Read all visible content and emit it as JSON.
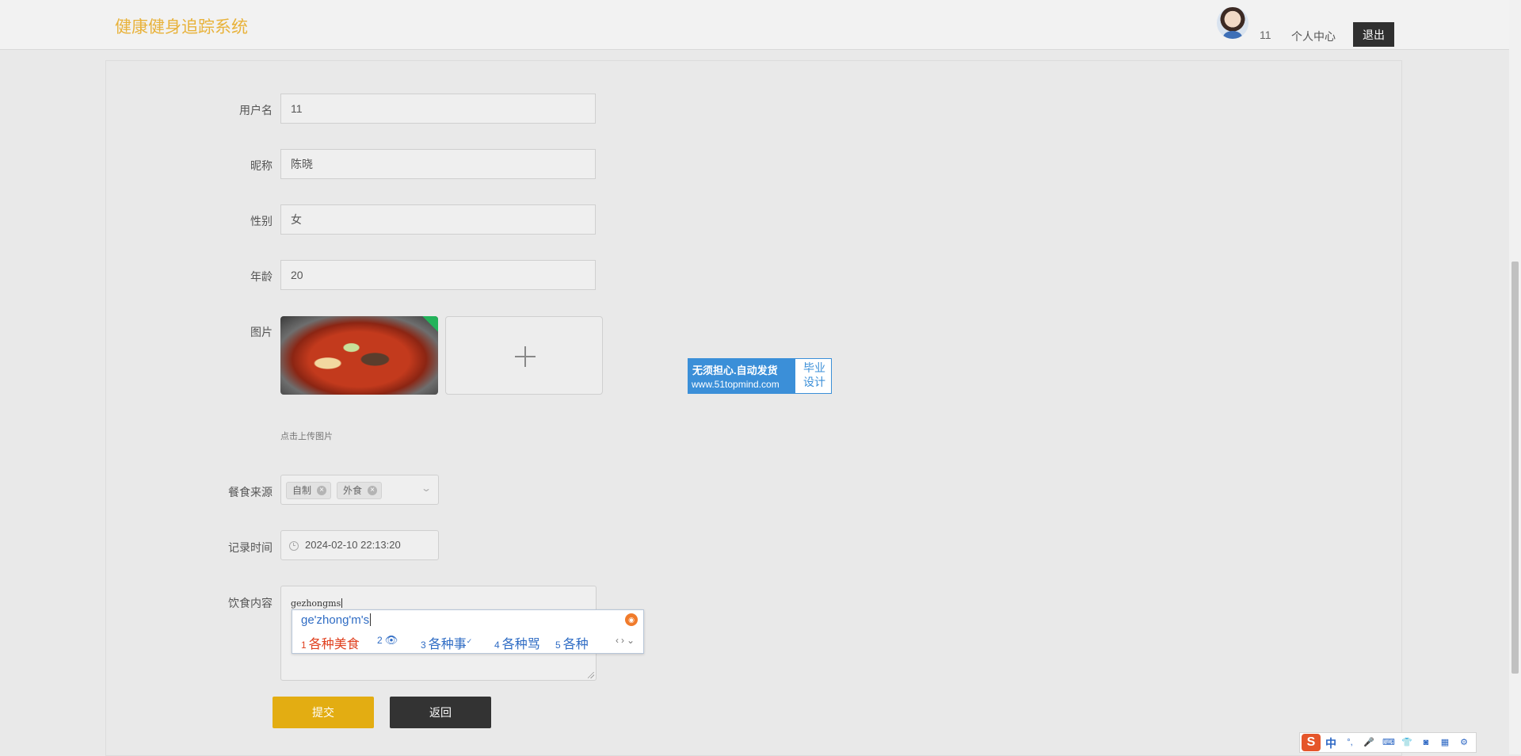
{
  "header": {
    "app_title": "健康健身追踪系统",
    "user_id": "11",
    "personal_center": "个人中心",
    "logout": "退出"
  },
  "form": {
    "username": {
      "label": "用户名",
      "value": "11"
    },
    "nickname": {
      "label": "昵称",
      "value": "陈晓"
    },
    "gender": {
      "label": "性别",
      "value": "女"
    },
    "age": {
      "label": "年龄",
      "value": "20"
    },
    "image": {
      "label": "图片",
      "upload_hint": "点击上传图片"
    },
    "meal_source": {
      "label": "餐食来源",
      "selected": [
        "自制",
        "外食"
      ]
    },
    "record_time": {
      "label": "记录时间",
      "value": "2024-02-10 22:13:20"
    },
    "diet_content": {
      "label": "饮食内容",
      "value": "gezhongms"
    },
    "submit": "提交",
    "back": "返回"
  },
  "ad": {
    "line1": "无须担心.自动发货",
    "line2": "www.51topmind.com",
    "right1": "毕业",
    "right2": "设计"
  },
  "ime_popup": {
    "composition": "ge'zhong'm's",
    "candidates": [
      {
        "n": "1",
        "text": "各种美食"
      },
      {
        "n": "2",
        "text": ""
      },
      {
        "n": "3",
        "text": "各种事"
      },
      {
        "n": "4",
        "text": "各种骂"
      },
      {
        "n": "5",
        "text": "各种"
      }
    ]
  },
  "ime_toolbar": {
    "mode": "中",
    "logo": "S"
  },
  "colors": {
    "accent_title": "#e8b23a",
    "submit_bg": "#e3ad12",
    "dark_button": "#333333",
    "ime_blue": "#2f6cc4",
    "ime_first": "#e0401f"
  }
}
